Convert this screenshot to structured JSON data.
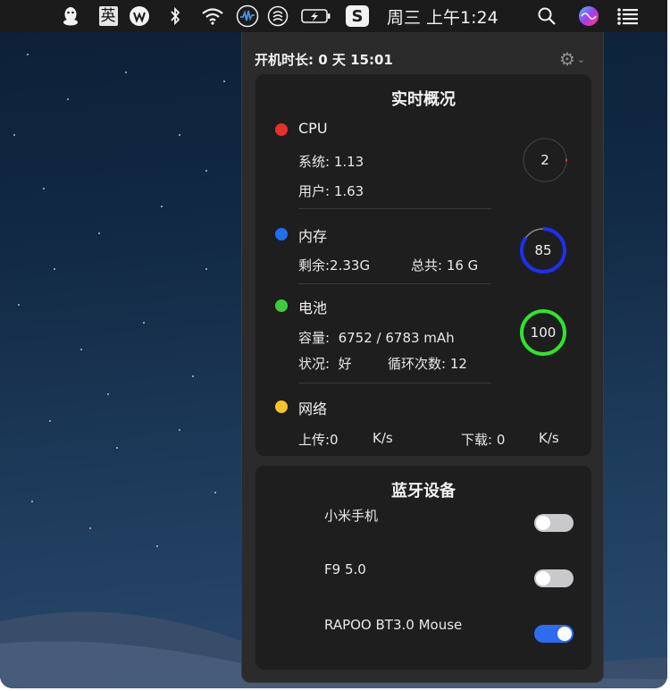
{
  "menubar": {
    "icons": [
      "qq-icon",
      "input-method-icon",
      "wps-icon",
      "bluetooth-icon",
      "wifi-icon",
      "audio-wave-icon",
      "radar-icon",
      "battery-charging-icon",
      "s-app-icon",
      "search-icon",
      "siri-icon",
      "control-center-icon"
    ],
    "input_method": "英",
    "s_app": "S",
    "clock": "周三 上午1:24"
  },
  "panel": {
    "uptime": "开机时长: 0 天 15:01",
    "settings_icon": "gear-icon"
  },
  "overview": {
    "title": "实时概况",
    "cpu": {
      "label": "CPU",
      "color": "#e8302b",
      "system": "系统: 1.13",
      "user": "用户: 1.63",
      "ring_value": "2",
      "ring_fraction": 0.02
    },
    "memory": {
      "label": "内存",
      "color": "#1f6ff2",
      "free": "剩余:2.33G",
      "total": "总共: 16 G",
      "ring_value": "85",
      "ring_fraction": 0.85
    },
    "battery": {
      "label": "电池",
      "color": "#3ecb3a",
      "capacity": "容量:  6752 / 6783 mAh",
      "status": "状况:  好",
      "cycles": "循环次数: 12",
      "ring_value": "100",
      "ring_fraction": 1.0
    },
    "network": {
      "label": "网络",
      "color": "#f5c42c",
      "upload": "上传:0",
      "upload_unit": "K/s",
      "download": "下载: 0",
      "download_unit": "K/s"
    }
  },
  "bluetooth": {
    "title": "蓝牙设备",
    "devices": [
      {
        "name": "小米手机",
        "enabled": false
      },
      {
        "name": "F9 5.0",
        "enabled": false
      },
      {
        "name": "RAPOO BT3.0 Mouse",
        "enabled": true
      }
    ]
  }
}
